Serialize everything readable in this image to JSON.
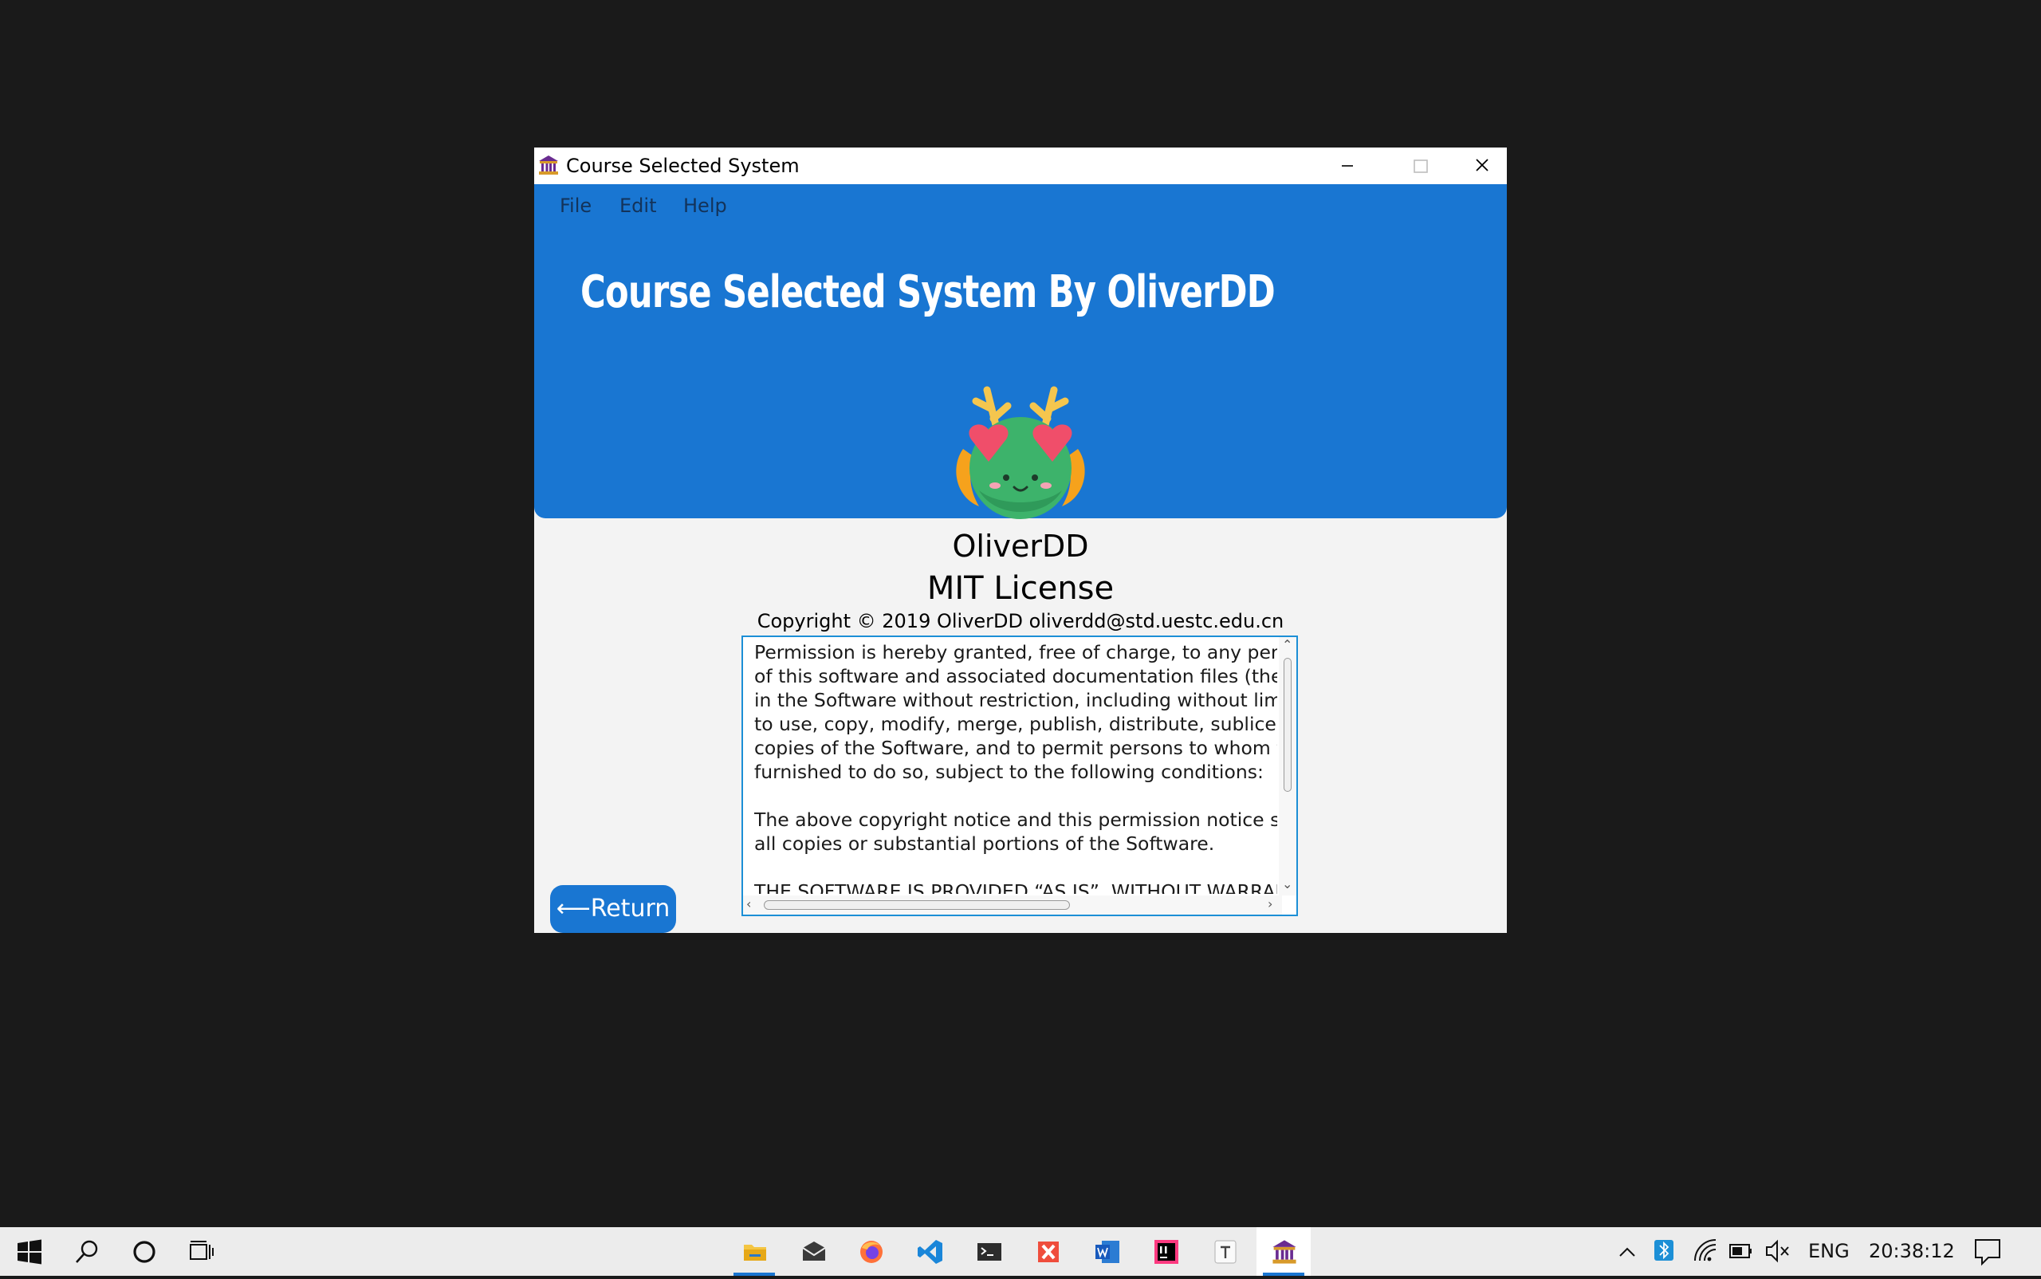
{
  "window": {
    "title": "Course Selected System",
    "controls": [
      "minimize",
      "maximize",
      "close"
    ]
  },
  "menu": {
    "items": [
      "File",
      "Edit",
      "Help"
    ]
  },
  "banner": {
    "title": "Course Selected System By OliverDD"
  },
  "about": {
    "author": "OliverDD",
    "license_name": "MIT License",
    "copyright": "Copyright © 2019 OliverDD oliverdd@std.uestc.edu.cn",
    "license_text": "Permission is hereby granted, free of charge, to any perso\nof this software and associated documentation files (the \"\nin the Software without restriction, including without limi\nto use, copy, modify, merge, publish, distribute, sublicens\ncopies of the Software, and to permit persons to whom th\nfurnished to do so, subject to the following conditions:\n\nThe above copyright notice and this permission notice sh\nall copies or substantial portions of the Software.\n\nTHE SOFTWARE IS PROVIDED “AS IS”, WITHOUT WARRAN"
  },
  "buttons": {
    "return_label": "⟵Return"
  },
  "taskbar": {
    "pinned": [
      "start-icon",
      "search-icon",
      "cortana-icon",
      "task-view-icon"
    ],
    "apps": [
      "file-explorer-icon",
      "mail-icon",
      "firefox-icon",
      "vscode-icon",
      "terminal-icon",
      "xmind-icon",
      "word-icon",
      "intellij-icon",
      "typora-icon",
      "course-system-icon"
    ],
    "language": "ENG",
    "clock": "20:38:12"
  },
  "colors": {
    "accent": "#1976d2",
    "background": "#1a1a1a",
    "window_body": "#f3f3f3",
    "taskbar": "#ececec"
  }
}
